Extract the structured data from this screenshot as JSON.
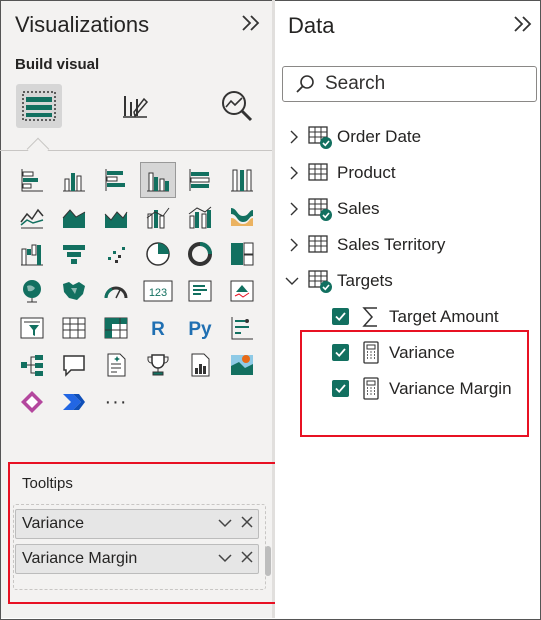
{
  "visualizations": {
    "title": "Visualizations",
    "build_visual_label": "Build visual",
    "more_label": "···"
  },
  "tooltips": {
    "label": "Tooltips",
    "fields": [
      {
        "label": "Variance"
      },
      {
        "label": "Variance Margin"
      }
    ]
  },
  "data": {
    "title": "Data",
    "search_placeholder": "Search",
    "tables": [
      {
        "label": "Order Date",
        "expanded": false,
        "has_check": true
      },
      {
        "label": "Product",
        "expanded": false,
        "has_check": false
      },
      {
        "label": "Sales",
        "expanded": false,
        "has_check": true
      },
      {
        "label": "Sales Territory",
        "expanded": false,
        "has_check": false
      },
      {
        "label": "Targets",
        "expanded": true,
        "has_check": true
      }
    ],
    "fields": [
      {
        "label": "Target Amount",
        "checked": true,
        "icon": "sigma-icon"
      },
      {
        "label": "Variance",
        "checked": true,
        "icon": "calculator-icon"
      },
      {
        "label": "Variance Margin",
        "checked": true,
        "icon": "calculator-icon"
      }
    ]
  },
  "colors": {
    "accent_teal": "#127060",
    "highlight_red": "#e81123",
    "pane_bg": "#f3f2f1"
  }
}
